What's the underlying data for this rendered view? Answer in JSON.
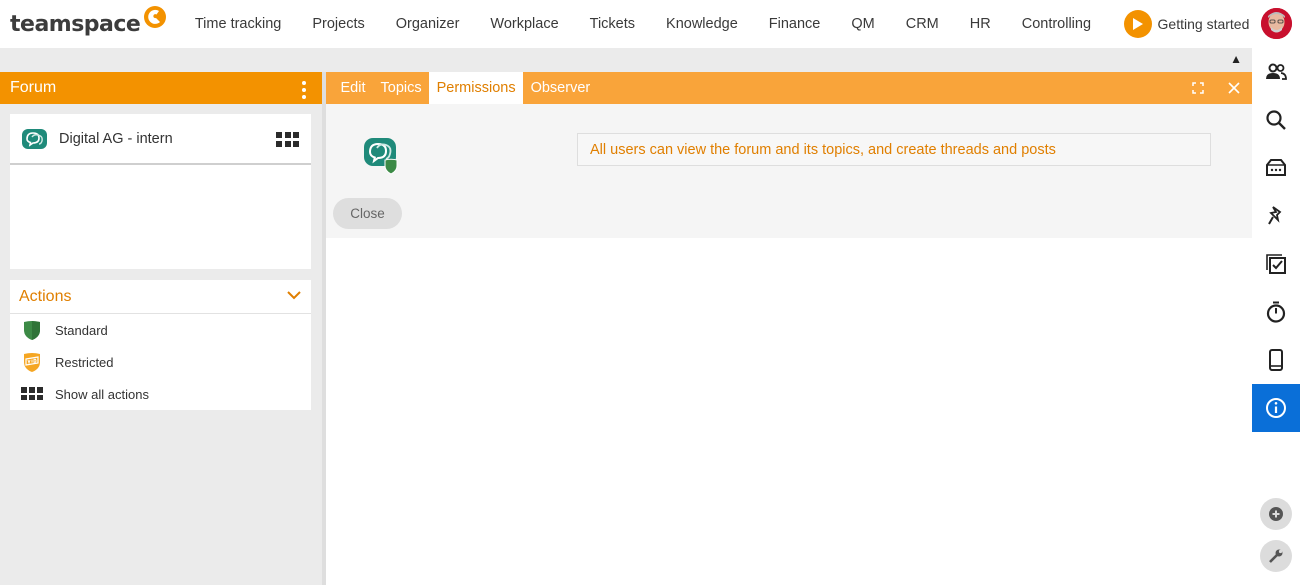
{
  "brand": {
    "name": "teamspace",
    "accent": "#f39200"
  },
  "nav": {
    "items": [
      "Time tracking",
      "Projects",
      "Organizer",
      "Workplace",
      "Tickets",
      "Knowledge",
      "Finance",
      "QM",
      "CRM",
      "HR",
      "Controlling"
    ],
    "getting_started": "Getting started"
  },
  "strip": {
    "caret": "▲"
  },
  "left_panel": {
    "title": "Forum",
    "forum_card": {
      "name": "Digital AG - intern"
    },
    "actions": {
      "title": "Actions",
      "items": [
        {
          "label": "Standard",
          "icon": "green-shield-icon"
        },
        {
          "label": "Restricted",
          "icon": "vip-shield-icon"
        },
        {
          "label": "Show all actions",
          "icon": "grid-icon"
        }
      ]
    }
  },
  "main_panel": {
    "tabs": [
      {
        "label": "Edit",
        "active": false
      },
      {
        "label": "Topics",
        "active": false
      },
      {
        "label": "Permissions",
        "active": true
      },
      {
        "label": "Observer",
        "active": false
      }
    ],
    "permission_text": "All users can view the forum and its topics, and create threads and posts",
    "close_label": "Close"
  },
  "right_sidebar": {
    "icons": [
      "users-icon",
      "search-icon",
      "inbox-icon",
      "pin-icon",
      "tasks-icon",
      "timer-icon",
      "mobile-icon",
      "info-icon",
      "add-icon",
      "wrench-icon"
    ],
    "active": "info-icon",
    "active_color": "#0a6fd8"
  }
}
